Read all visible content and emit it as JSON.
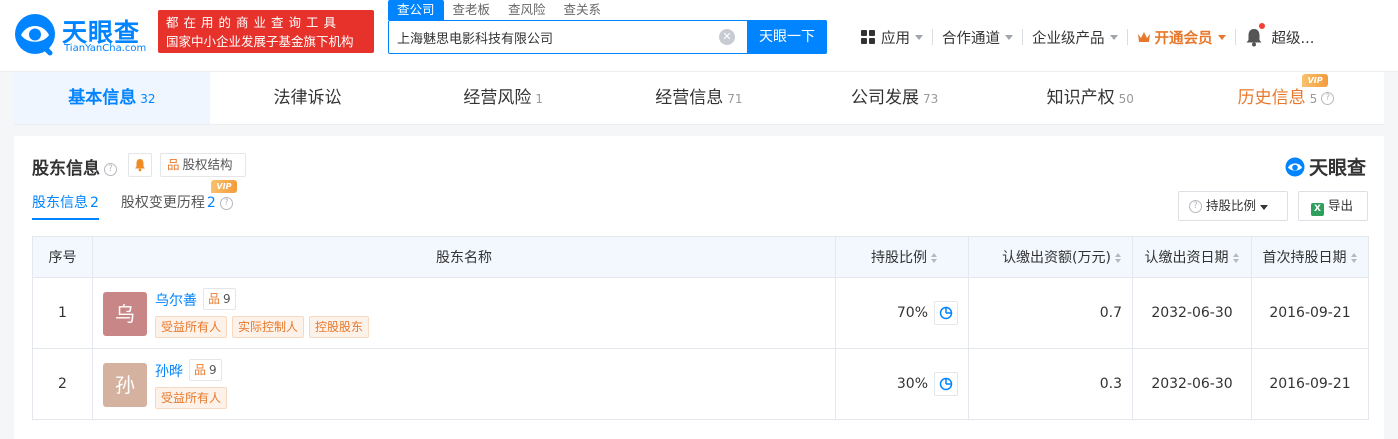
{
  "header": {
    "logo_cn": "天眼查",
    "logo_en": "TianYanCha.com",
    "slogan_line1": "都在用的商业查询工具",
    "slogan_line2": "国家中小企业发展子基金旗下机构",
    "search_tabs": [
      {
        "label": "查公司",
        "active": true
      },
      {
        "label": "查老板",
        "active": false
      },
      {
        "label": "查风险",
        "active": false
      },
      {
        "label": "查关系",
        "active": false
      }
    ],
    "search_value": "上海魅思电影科技有限公司",
    "search_button": "天眼一下",
    "nav": {
      "apps": "应用",
      "partner": "合作通道",
      "enterprise": "企业级产品",
      "vip": "开通会员",
      "user": "超级..."
    }
  },
  "main_tabs": [
    {
      "label": "基本信息",
      "count": "32",
      "active": true
    },
    {
      "label": "法律诉讼",
      "count": "",
      "active": false
    },
    {
      "label": "经营风险",
      "count": "1",
      "active": false
    },
    {
      "label": "经营信息",
      "count": "71",
      "active": false
    },
    {
      "label": "公司发展",
      "count": "73",
      "active": false
    },
    {
      "label": "知识产权",
      "count": "50",
      "active": false
    },
    {
      "label": "历史信息",
      "count": "5",
      "active": false,
      "vip": "VIP"
    }
  ],
  "section": {
    "title": "股东信息",
    "structure_button": "股权结构",
    "brand": "天眼查",
    "sub_tabs": [
      {
        "label": "股东信息",
        "count": "2",
        "active": true
      },
      {
        "label": "股权变更历程",
        "count": "2",
        "active": false,
        "vip": "VIP"
      }
    ],
    "ratio_button": "持股比例",
    "export_button": "导出"
  },
  "table": {
    "columns": [
      "序号",
      "股东名称",
      "持股比例",
      "认缴出资额(万元)",
      "认缴出资日期",
      "首次持股日期"
    ],
    "rows": [
      {
        "index": "1",
        "avatar": "乌",
        "name": "乌尔善",
        "related_count": "9",
        "tags": [
          "受益所有人",
          "实际控制人",
          "控股股东"
        ],
        "ratio": "70%",
        "capital": "0.7",
        "capital_date": "2032-06-30",
        "first_date": "2016-09-21"
      },
      {
        "index": "2",
        "avatar": "孙",
        "name": "孙晔",
        "related_count": "9",
        "tags": [
          "受益所有人"
        ],
        "ratio": "30%",
        "capital": "0.3",
        "capital_date": "2032-06-30",
        "first_date": "2016-09-21"
      }
    ]
  },
  "colors": {
    "brand_blue": "#0084ff",
    "slogan_red": "#e7322c",
    "vip_orange": "#e8792c",
    "avatar1": "#c98686",
    "avatar2": "#d4b29f"
  }
}
